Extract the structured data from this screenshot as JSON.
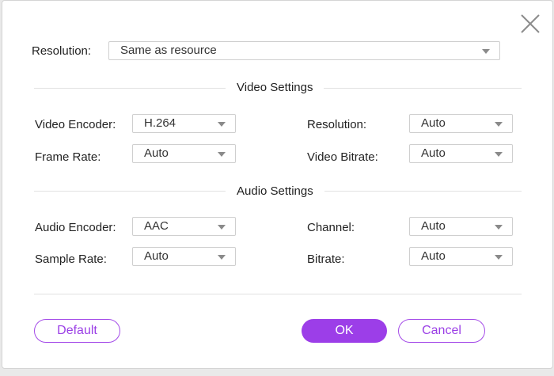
{
  "dialog": {
    "resolution_label": "Resolution:",
    "resolution_value": "Same as resource"
  },
  "video": {
    "section_title": "Video Settings",
    "encoder_label": "Video Encoder:",
    "encoder_value": "H.264",
    "resolution_label": "Resolution:",
    "resolution_value": "Auto",
    "frame_rate_label": "Frame Rate:",
    "frame_rate_value": "Auto",
    "bitrate_label": "Video Bitrate:",
    "bitrate_value": "Auto"
  },
  "audio": {
    "section_title": "Audio Settings",
    "encoder_label": "Audio Encoder:",
    "encoder_value": "AAC",
    "channel_label": "Channel:",
    "channel_value": "Auto",
    "sample_rate_label": "Sample Rate:",
    "sample_rate_value": "Auto",
    "bitrate_label": "Bitrate:",
    "bitrate_value": "Auto"
  },
  "buttons": {
    "default_label": "Default",
    "ok_label": "OK",
    "cancel_label": "Cancel"
  },
  "colors": {
    "accent": "#9c3ee8",
    "divider": "#e2e2e2"
  },
  "icons": {
    "close": "close-icon",
    "dropdown": "chevron-down-icon"
  }
}
